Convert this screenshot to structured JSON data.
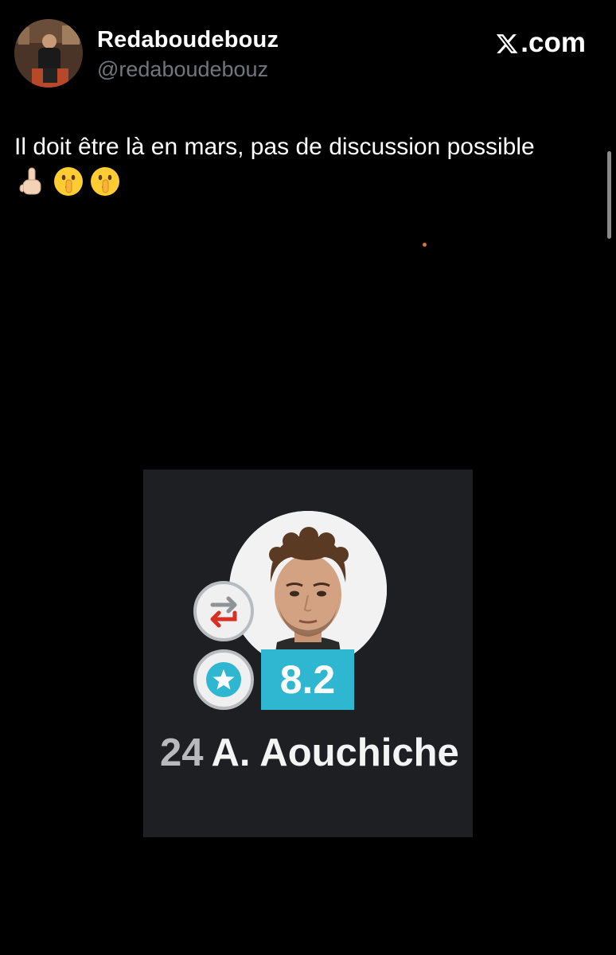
{
  "tweet": {
    "author_name": "Redaboudebouz",
    "author_handle": "@redaboudebouz",
    "site_label": ".com",
    "site_logo": "x-logo-icon",
    "text": "Il doit être là en mars, pas de discussion possible",
    "emojis": [
      "pointing-up-icon",
      "shushing-face-icon",
      "shushing-face-icon"
    ]
  },
  "media": {
    "shirt_number": "24",
    "player_name": "A. Aouchiche",
    "rating": "8.2",
    "badges": [
      "substitution-icon",
      "star-icon"
    ],
    "rating_color": "#2fb6d1"
  }
}
